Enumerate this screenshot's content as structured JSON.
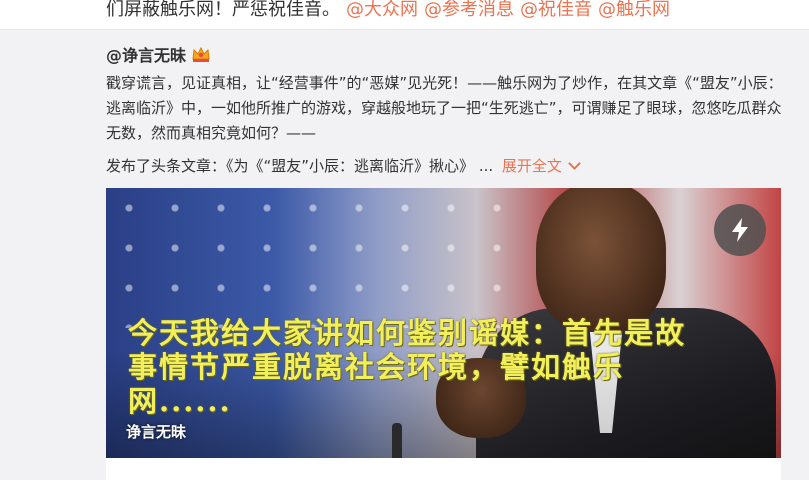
{
  "prev_post": {
    "text": "们屏蔽触乐网！严惩祝佳音。",
    "mentions": [
      "@大众网",
      "@参考消息",
      "@祝佳音",
      "@触乐网"
    ]
  },
  "post": {
    "author": "@诤言无昧",
    "badge_icon": "vip-crown-icon",
    "body": "戳穿谎言，见证真相，让“经营事件”的“恶媒”见光死！——触乐网为了炒作，在其文章《“盟友”小辰：逃离临沂》中，一如他所推广的游戏，穿越般地玩了一把“生死逃亡”，可谓赚足了眼球，忽悠吃瓜群众无数，然而真相究竟如何？——",
    "article_prefix": "发布了头条文章：《为《“盟友”小辰：逃离临沂》揪心》",
    "ellipsis": "...",
    "expand_label": "展开全文",
    "card": {
      "overlay_text": "今天我给大家讲如何鉴别谣媒：首先是故事情节严重脱离社会环境，譬如触乐网......",
      "watermark": "诤言无昧",
      "action_icon": "lightning-icon"
    }
  },
  "colors": {
    "accent": "#eb7350",
    "overlay_text": "#f3ef5a",
    "background": "#f2f2f5"
  }
}
